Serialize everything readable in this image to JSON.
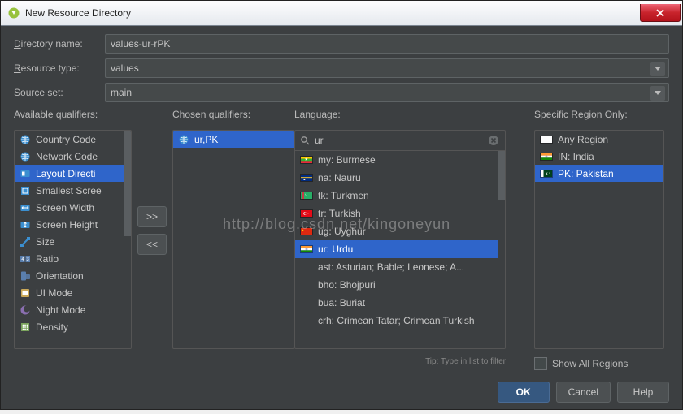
{
  "title": "New Resource Directory",
  "labels": {
    "dir_name": "Directory name:",
    "dir_name_mn": "D",
    "res_type": "Resource type:",
    "res_type_mn": "R",
    "source_set": "Source set:",
    "source_set_mn": "S",
    "available": "Available qualifiers:",
    "available_mn": "A",
    "chosen": "Chosen qualifiers:",
    "chosen_mn": "C",
    "language": "Language:",
    "region": "Specific Region Only:",
    "tip": "Tip: Type in list to filter",
    "show_all": "Show All Regions"
  },
  "form": {
    "dir_name": "values-ur-rPK",
    "res_type": "values",
    "source_set": "main"
  },
  "search": {
    "value": "ur"
  },
  "available": [
    {
      "label": "Country Code",
      "icon": "globe",
      "color": "#3b8fd0"
    },
    {
      "label": "Network Code",
      "icon": "globe",
      "color": "#3b8fd0"
    },
    {
      "label": "Layout Directi",
      "icon": "layout",
      "color": "#3b8fd0",
      "selected": true
    },
    {
      "label": "Smallest Scree",
      "icon": "square",
      "color": "#3b8fd0"
    },
    {
      "label": "Screen Width",
      "icon": "width",
      "color": "#3b8fd0"
    },
    {
      "label": "Screen Height",
      "icon": "height",
      "color": "#3b8fd0"
    },
    {
      "label": "Size",
      "icon": "size",
      "color": "#3b8fd0"
    },
    {
      "label": "Ratio",
      "icon": "ratio",
      "color": "#5a7fae"
    },
    {
      "label": "Orientation",
      "icon": "orient",
      "color": "#5a7fae"
    },
    {
      "label": "UI Mode",
      "icon": "ui",
      "color": "#caa858"
    },
    {
      "label": "Night Mode",
      "icon": "night",
      "color": "#8a6fb0"
    },
    {
      "label": "Density",
      "icon": "density",
      "color": "#7aa35d"
    }
  ],
  "chosen": [
    {
      "label": "ur,PK",
      "icon": "globe",
      "color": "#3b8fd0",
      "selected": true
    }
  ],
  "languages": [
    {
      "flag": "mm",
      "label": "my: Burmese"
    },
    {
      "flag": "nr",
      "label": "na: Nauru"
    },
    {
      "flag": "tm",
      "label": "tk: Turkmen"
    },
    {
      "flag": "tr",
      "label": "tr: Turkish"
    },
    {
      "flag": "cn",
      "label": "ug: Uyghur"
    },
    {
      "flag": "in",
      "label": "ur: Urdu",
      "selected": true
    },
    {
      "flag": "",
      "label": "ast: Asturian; Bable; Leonese; A..."
    },
    {
      "flag": "",
      "label": "bho: Bhojpuri"
    },
    {
      "flag": "",
      "label": "bua: Buriat"
    },
    {
      "flag": "",
      "label": "crh: Crimean Tatar; Crimean Turkish"
    }
  ],
  "regions": [
    {
      "flag": "white",
      "label": "Any Region"
    },
    {
      "flag": "in",
      "label": "IN: India"
    },
    {
      "flag": "pk",
      "label": "PK: Pakistan",
      "selected": true
    }
  ],
  "buttons": {
    "ok": "OK",
    "cancel": "Cancel",
    "help": "Help",
    "add": ">>",
    "remove": "<<"
  },
  "watermark": "http://blog.csdn.net/kingoneyun"
}
